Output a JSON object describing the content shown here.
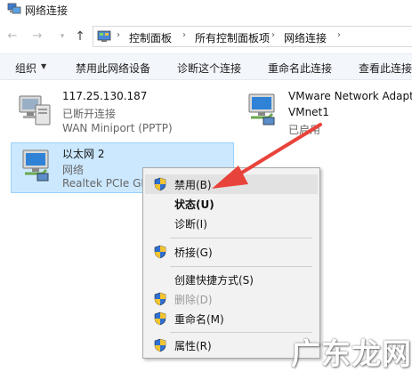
{
  "window": {
    "title": "网络连接"
  },
  "address": {
    "crumbs": [
      "控制面板",
      "所有控制面板项",
      "网络连接"
    ],
    "separator": "›"
  },
  "toolbar": {
    "organize": "组织",
    "organize_arrow": "▼",
    "disable_device": "禁用此网络设备",
    "diagnose": "诊断这个连接",
    "rename": "重命名此连接",
    "view_status": "查看此连接"
  },
  "connections": [
    {
      "name": "117.25.130.187",
      "status": "已断开连接",
      "device": "WAN Miniport (PPTP)",
      "icon": "network-computer-disconnected-icon"
    },
    {
      "name": "VMware Network Adapter",
      "status": "VMnet1",
      "device": "已启用",
      "icon": "network-adapter-icon"
    },
    {
      "name": "以太网 2",
      "status": "网络",
      "device": "Realtek PCIe GBE",
      "icon": "network-adapter-icon"
    }
  ],
  "context_menu": {
    "items": [
      {
        "label": "禁用(B)",
        "shield": true,
        "bold": false,
        "disabled": false,
        "highlighted": true
      },
      {
        "label": "状态(U)",
        "shield": false,
        "bold": true,
        "disabled": false
      },
      {
        "label": "诊断(I)",
        "shield": false,
        "bold": false,
        "disabled": false
      },
      {
        "label": "桥接(G)",
        "shield": true,
        "bold": false,
        "disabled": false
      },
      {
        "label": "创建快捷方式(S)",
        "shield": false,
        "bold": false,
        "disabled": false
      },
      {
        "label": "删除(D)",
        "shield": true,
        "bold": false,
        "disabled": true
      },
      {
        "label": "重命名(M)",
        "shield": true,
        "bold": false,
        "disabled": false
      },
      {
        "label": "属性(R)",
        "shield": true,
        "bold": false,
        "disabled": false
      }
    ]
  },
  "colors": {
    "selection_bg": "#cce8ff",
    "selection_border": "#99d1ff",
    "annotation_arrow": "#e8433b",
    "menu_bg": "#f2f2f2"
  },
  "watermark": "广东龙网"
}
